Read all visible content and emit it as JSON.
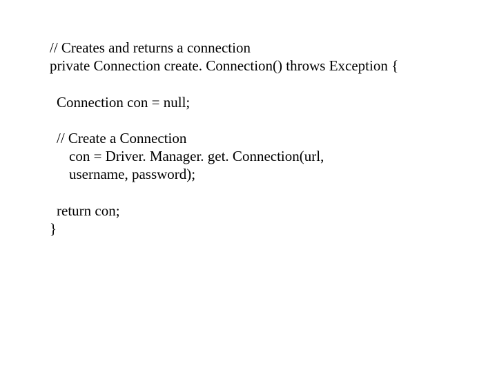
{
  "code": {
    "l1": "// Creates and returns a connection",
    "l2": "private Connection create. Connection() throws Exception {",
    "l3": "Connection con = null;",
    "l4": "// Create a Connection",
    "l5": "con = Driver. Manager. get. Connection(url,",
    "l6": "username, password);",
    "l7": "return con;",
    "l8": "}"
  }
}
